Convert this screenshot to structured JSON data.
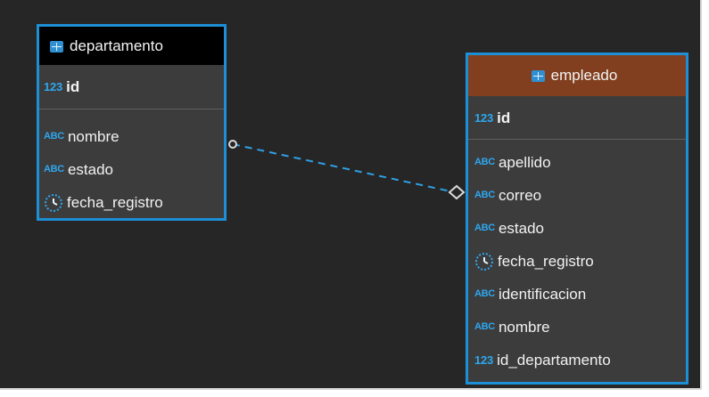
{
  "diagram": {
    "entities": [
      {
        "id": "departamento",
        "name": "departamento",
        "header_color": "#000000",
        "border_color": "#1d8fd6",
        "primary_key": {
          "type": "123",
          "name": "id"
        },
        "attributes": [
          {
            "type": "ABC",
            "name": "nombre"
          },
          {
            "type": "ABC",
            "name": "estado"
          },
          {
            "type": "timestamp-icon",
            "name": "fecha_registro"
          }
        ]
      },
      {
        "id": "empleado",
        "name": "empleado",
        "header_color": "#823f1f",
        "border_color": "#1d8fd6",
        "primary_key": {
          "type": "123",
          "name": "id"
        },
        "attributes": [
          {
            "type": "ABC",
            "name": "apellido"
          },
          {
            "type": "ABC",
            "name": "correo"
          },
          {
            "type": "ABC",
            "name": "estado"
          },
          {
            "type": "timestamp-icon",
            "name": "fecha_registro"
          },
          {
            "type": "ABC",
            "name": "identificacion"
          },
          {
            "type": "ABC",
            "name": "nombre"
          },
          {
            "type": "123",
            "name": "id_departamento"
          }
        ]
      }
    ],
    "relationship": {
      "from": "departamento",
      "to": "empleado",
      "line_style": "dashed",
      "line_color": "#2f9fe5",
      "start_marker": "circle",
      "end_marker": "diamond"
    }
  }
}
